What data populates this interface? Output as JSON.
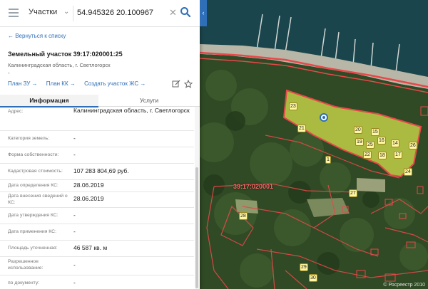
{
  "search": {
    "category": "Участки",
    "coordinates": "54.945326 20.100967"
  },
  "panel": {
    "back_link": "← Вернуться к списку",
    "title": "Земельный участок 39:17:020001:25",
    "address": "Калининградская область, г. Светлогорск",
    "dash": "-",
    "links": [
      "План ЗУ →",
      "План КК →",
      "Создать участок ЖС →"
    ],
    "tabs": [
      "Информация",
      "Услуги"
    ],
    "rows": [
      {
        "label": "Адрес:",
        "value": "Калининградская область, г. Светлогорск"
      },
      {
        "label": "Категория земель:",
        "value": "-"
      },
      {
        "label": "Форма собственности:",
        "value": "-"
      },
      {
        "label": "Кадастровая стоимость:",
        "value": "107 283 804,69 руб."
      },
      {
        "label": "Дата определения КС:",
        "value": "28.06.2019"
      },
      {
        "label": "Дата внесения сведений о КС:",
        "value": "28.06.2019"
      },
      {
        "label": "Дата утверждения КС:",
        "value": "-"
      },
      {
        "label": "Дата применения КС:",
        "value": "-"
      },
      {
        "label": "Площадь уточненная:",
        "value": "46 587 кв. м"
      },
      {
        "label": "Разрешенное использование:",
        "value": "-"
      },
      {
        "label": "по документу:",
        "value": "-"
      }
    ]
  },
  "map": {
    "block_label": "39:17:020001",
    "lot_numbers": [
      "23",
      "20",
      "15",
      "19",
      "25",
      "16",
      "14",
      "17",
      "18",
      "22",
      "26",
      "24",
      "21",
      "1",
      "27",
      "28",
      "29",
      "30"
    ],
    "attribution": "© Росреестр 2010",
    "colors": {
      "parcel_fill": "#d6e04a",
      "boundary": "#e8484a",
      "accent": "#2e6fb8"
    }
  },
  "icons": [
    "menu-icon",
    "chevron-down-icon",
    "close-icon",
    "search-icon",
    "chevron-left-icon",
    "edit-icon",
    "star-icon",
    "location-pin-icon"
  ]
}
